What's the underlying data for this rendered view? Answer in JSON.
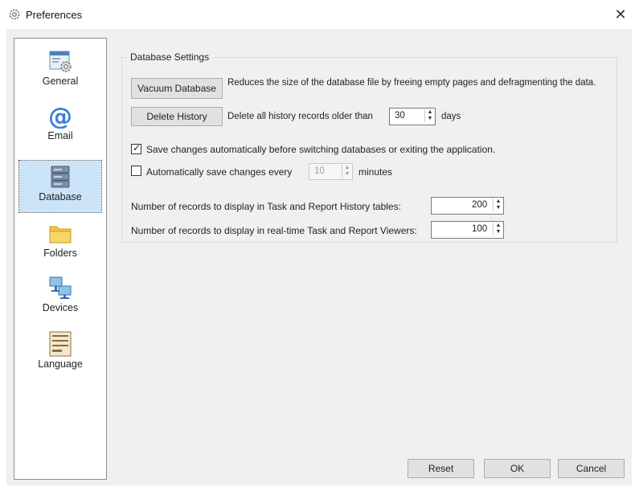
{
  "window": {
    "title": "Preferences",
    "close_glyph": "✕",
    "icon": "gear-icon"
  },
  "sidebar": {
    "items": [
      {
        "label": "General",
        "icon": "general-settings-icon"
      },
      {
        "label": "Email",
        "icon": "at-sign-icon"
      },
      {
        "label": "Database",
        "icon": "database-icon",
        "selected": true
      },
      {
        "label": "Folders",
        "icon": "folder-icon"
      },
      {
        "label": "Devices",
        "icon": "devices-icon"
      },
      {
        "label": "Language",
        "icon": "language-icon"
      }
    ]
  },
  "database_settings": {
    "group_title": "Database Settings",
    "vacuum_button": "Vacuum Database",
    "vacuum_desc": "Reduces the size of the database file by freeing empty pages and defragmenting the data.",
    "delete_history_button": "Delete History",
    "delete_history_desc": "Delete all history records older than",
    "delete_history_value": "30",
    "delete_history_unit": "days",
    "autosave_switch_checked": true,
    "autosave_switch_label": "Save changes automatically before switching databases or exiting the application.",
    "autosave_interval_checked": false,
    "autosave_interval_label": "Automatically save changes every",
    "autosave_interval_value": "10",
    "autosave_interval_unit": "minutes",
    "history_records_label": "Number of records to display in Task and Report History tables:",
    "history_records_value": "200",
    "realtime_records_label": "Number of records to display in real-time Task and Report Viewers:",
    "realtime_records_value": "100"
  },
  "footer": {
    "reset": "Reset",
    "ok": "OK",
    "cancel": "Cancel"
  },
  "colors": {
    "selection": "#cce4f7",
    "dialog_bg": "#f0f0f0",
    "button_bg": "#e1e1e1"
  }
}
